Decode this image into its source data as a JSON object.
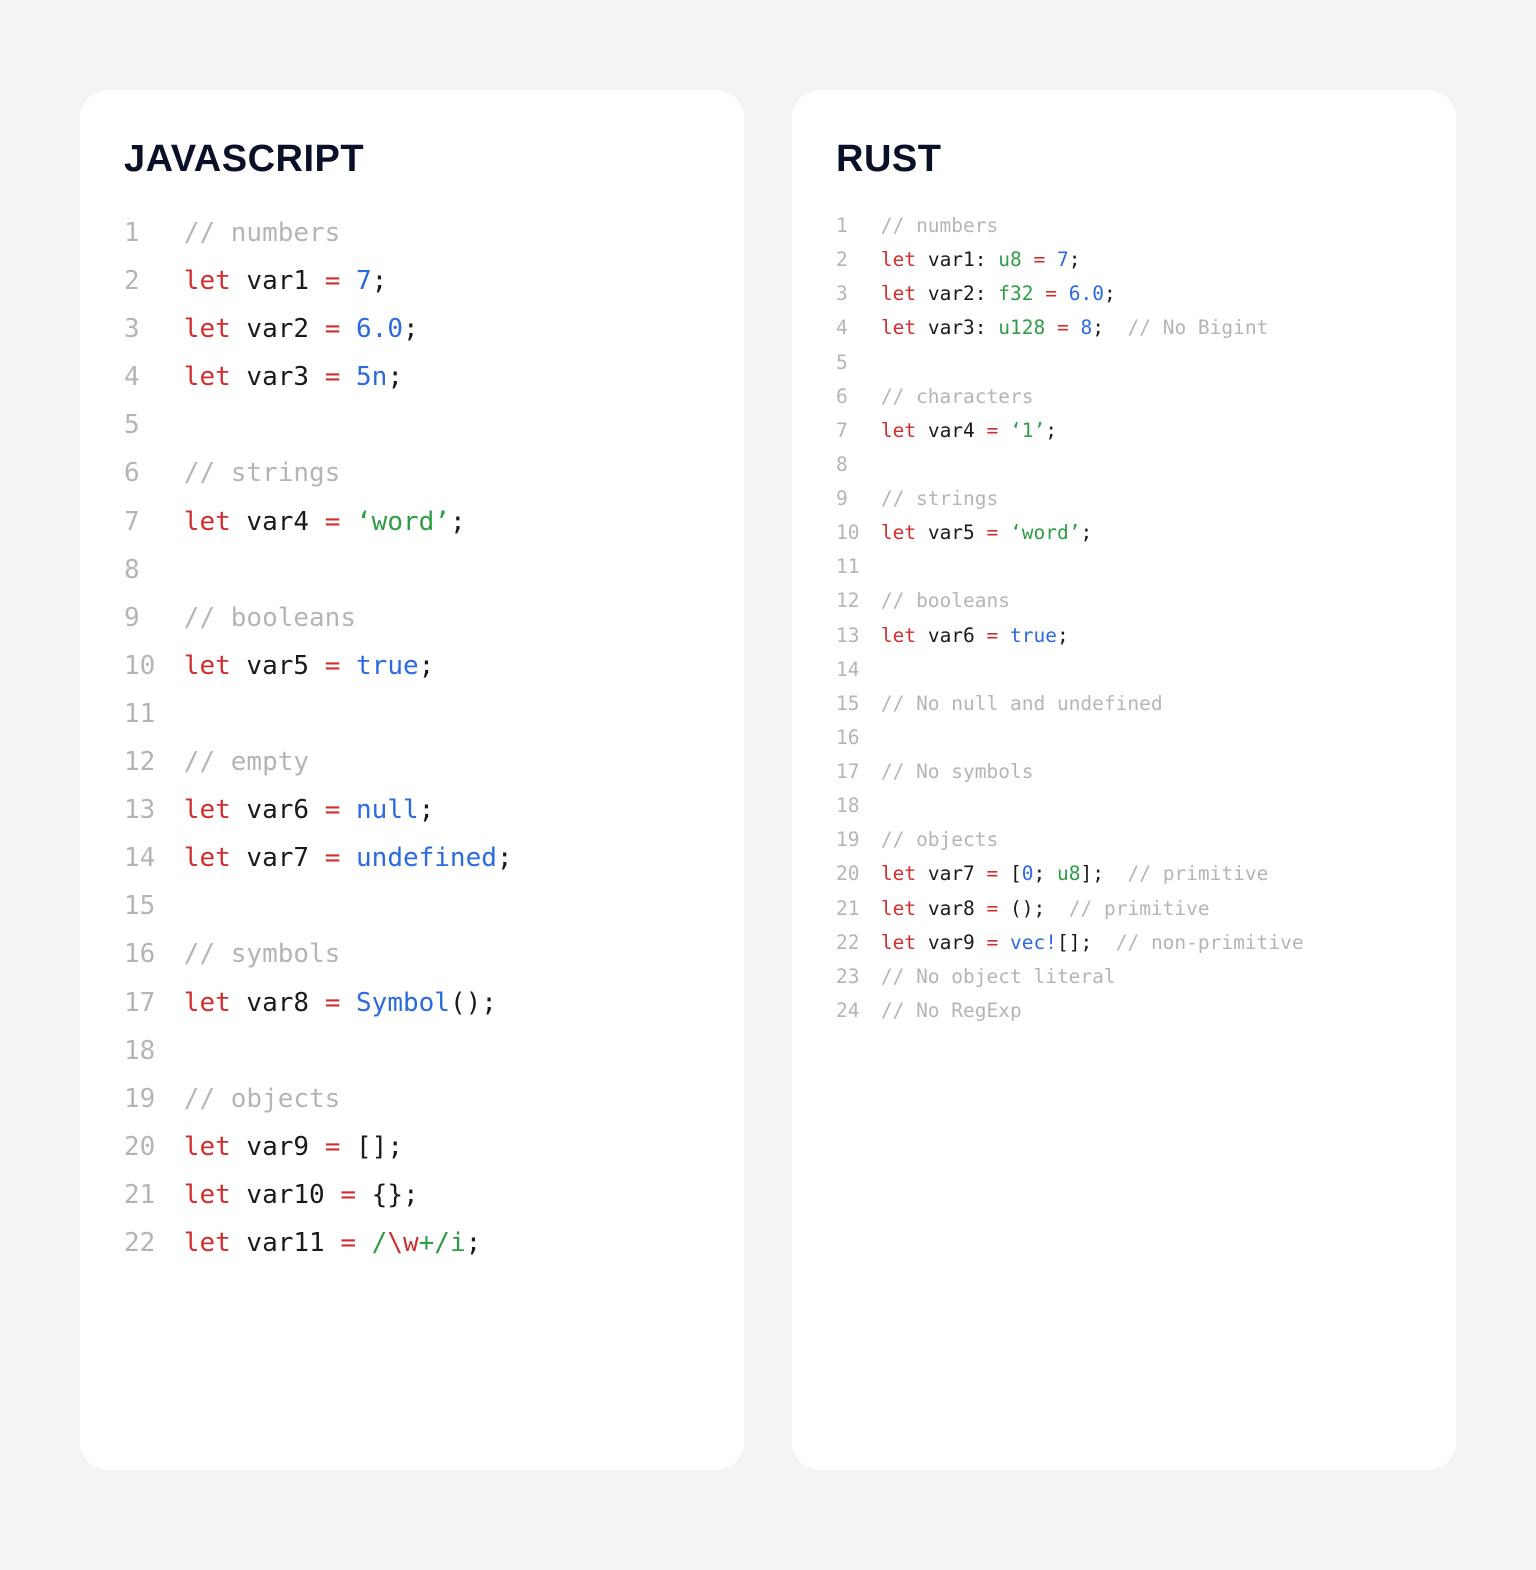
{
  "left": {
    "title": "JAVASCRIPT",
    "lines": [
      {
        "n": "1",
        "segs": [
          [
            "cm",
            "// numbers"
          ]
        ]
      },
      {
        "n": "2",
        "segs": [
          [
            "kw",
            "let"
          ],
          [
            "pn",
            " "
          ],
          [
            "nm",
            "var1"
          ],
          [
            "pn",
            " "
          ],
          [
            "op",
            "="
          ],
          [
            "pn",
            " "
          ],
          [
            "nu",
            "7"
          ],
          [
            "pn",
            ";"
          ]
        ]
      },
      {
        "n": "3",
        "segs": [
          [
            "kw",
            "let"
          ],
          [
            "pn",
            " "
          ],
          [
            "nm",
            "var2"
          ],
          [
            "pn",
            " "
          ],
          [
            "op",
            "="
          ],
          [
            "pn",
            " "
          ],
          [
            "nu",
            "6.0"
          ],
          [
            "pn",
            ";"
          ]
        ]
      },
      {
        "n": "4",
        "segs": [
          [
            "kw",
            "let"
          ],
          [
            "pn",
            " "
          ],
          [
            "nm",
            "var3"
          ],
          [
            "pn",
            " "
          ],
          [
            "op",
            "="
          ],
          [
            "pn",
            " "
          ],
          [
            "nu",
            "5n"
          ],
          [
            "pn",
            ";"
          ]
        ]
      },
      {
        "n": "5",
        "segs": [
          [
            "pn",
            ""
          ]
        ]
      },
      {
        "n": "6",
        "segs": [
          [
            "cm",
            "// strings"
          ]
        ]
      },
      {
        "n": "7",
        "segs": [
          [
            "kw",
            "let"
          ],
          [
            "pn",
            " "
          ],
          [
            "nm",
            "var4"
          ],
          [
            "pn",
            " "
          ],
          [
            "op",
            "="
          ],
          [
            "pn",
            " "
          ],
          [
            "st",
            "‘word’"
          ],
          [
            "pn",
            ";"
          ]
        ]
      },
      {
        "n": "8",
        "segs": [
          [
            "pn",
            ""
          ]
        ]
      },
      {
        "n": "9",
        "segs": [
          [
            "cm",
            "// booleans"
          ]
        ]
      },
      {
        "n": "10",
        "segs": [
          [
            "kw",
            "let"
          ],
          [
            "pn",
            " "
          ],
          [
            "nm",
            "var5"
          ],
          [
            "pn",
            " "
          ],
          [
            "op",
            "="
          ],
          [
            "pn",
            " "
          ],
          [
            "nu",
            "true"
          ],
          [
            "pn",
            ";"
          ]
        ]
      },
      {
        "n": "11",
        "segs": [
          [
            "pn",
            ""
          ]
        ]
      },
      {
        "n": "12",
        "segs": [
          [
            "cm",
            "// empty"
          ]
        ]
      },
      {
        "n": "13",
        "segs": [
          [
            "kw",
            "let"
          ],
          [
            "pn",
            " "
          ],
          [
            "nm",
            "var6"
          ],
          [
            "pn",
            " "
          ],
          [
            "op",
            "="
          ],
          [
            "pn",
            " "
          ],
          [
            "nu",
            "null"
          ],
          [
            "pn",
            ";"
          ]
        ]
      },
      {
        "n": "14",
        "segs": [
          [
            "kw",
            "let"
          ],
          [
            "pn",
            " "
          ],
          [
            "nm",
            "var7"
          ],
          [
            "pn",
            " "
          ],
          [
            "op",
            "="
          ],
          [
            "pn",
            " "
          ],
          [
            "nu",
            "undefined"
          ],
          [
            "pn",
            ";"
          ]
        ]
      },
      {
        "n": "15",
        "segs": [
          [
            "pn",
            ""
          ]
        ]
      },
      {
        "n": "16",
        "segs": [
          [
            "cm",
            "// symbols"
          ]
        ]
      },
      {
        "n": "17",
        "segs": [
          [
            "kw",
            "let"
          ],
          [
            "pn",
            " "
          ],
          [
            "nm",
            "var8"
          ],
          [
            "pn",
            " "
          ],
          [
            "op",
            "="
          ],
          [
            "pn",
            " "
          ],
          [
            "nu",
            "Symbol"
          ],
          [
            "pn",
            "();"
          ]
        ]
      },
      {
        "n": "18",
        "segs": [
          [
            "pn",
            ""
          ]
        ]
      },
      {
        "n": "19",
        "segs": [
          [
            "cm",
            "// objects"
          ]
        ]
      },
      {
        "n": "20",
        "segs": [
          [
            "kw",
            "let"
          ],
          [
            "pn",
            " "
          ],
          [
            "nm",
            "var9"
          ],
          [
            "pn",
            " "
          ],
          [
            "op",
            "="
          ],
          [
            "pn",
            " [];"
          ]
        ]
      },
      {
        "n": "21",
        "segs": [
          [
            "kw",
            "let"
          ],
          [
            "pn",
            " "
          ],
          [
            "nm",
            "var10"
          ],
          [
            "pn",
            " "
          ],
          [
            "op",
            "="
          ],
          [
            "pn",
            " {};"
          ]
        ]
      },
      {
        "n": "22",
        "segs": [
          [
            "kw",
            "let"
          ],
          [
            "pn",
            " "
          ],
          [
            "nm",
            "var11"
          ],
          [
            "pn",
            " "
          ],
          [
            "op",
            "="
          ],
          [
            "pn",
            " "
          ],
          [
            "st",
            "/"
          ],
          [
            "op",
            "\\w"
          ],
          [
            "st",
            "+/i"
          ],
          [
            "pn",
            ";"
          ]
        ]
      }
    ]
  },
  "right": {
    "title": "RUST",
    "lines": [
      {
        "n": "1",
        "segs": [
          [
            "cm",
            "// numbers"
          ]
        ]
      },
      {
        "n": "2",
        "segs": [
          [
            "kw",
            "let"
          ],
          [
            "pn",
            " "
          ],
          [
            "nm",
            "var1"
          ],
          [
            "pn",
            ": "
          ],
          [
            "tp",
            "u8"
          ],
          [
            "pn",
            " "
          ],
          [
            "op",
            "="
          ],
          [
            "pn",
            " "
          ],
          [
            "nu",
            "7"
          ],
          [
            "pn",
            ";"
          ]
        ]
      },
      {
        "n": "3",
        "segs": [
          [
            "kw",
            "let"
          ],
          [
            "pn",
            " "
          ],
          [
            "nm",
            "var2"
          ],
          [
            "pn",
            ": "
          ],
          [
            "tp",
            "f32"
          ],
          [
            "pn",
            " "
          ],
          [
            "op",
            "="
          ],
          [
            "pn",
            " "
          ],
          [
            "nu",
            "6.0"
          ],
          [
            "pn",
            ";"
          ]
        ]
      },
      {
        "n": "4",
        "segs": [
          [
            "kw",
            "let"
          ],
          [
            "pn",
            " "
          ],
          [
            "nm",
            "var3"
          ],
          [
            "pn",
            ": "
          ],
          [
            "tp",
            "u128"
          ],
          [
            "pn",
            " "
          ],
          [
            "op",
            "="
          ],
          [
            "pn",
            " "
          ],
          [
            "nu",
            "8"
          ],
          [
            "pn",
            ";  "
          ],
          [
            "cm",
            "// No Bigint"
          ]
        ]
      },
      {
        "n": "5",
        "segs": [
          [
            "pn",
            ""
          ]
        ]
      },
      {
        "n": "6",
        "segs": [
          [
            "cm",
            "// characters"
          ]
        ]
      },
      {
        "n": "7",
        "segs": [
          [
            "kw",
            "let"
          ],
          [
            "pn",
            " "
          ],
          [
            "nm",
            "var4"
          ],
          [
            "pn",
            " "
          ],
          [
            "op",
            "="
          ],
          [
            "pn",
            " "
          ],
          [
            "ch",
            "‘1’"
          ],
          [
            "pn",
            ";"
          ]
        ]
      },
      {
        "n": "8",
        "segs": [
          [
            "pn",
            ""
          ]
        ]
      },
      {
        "n": "9",
        "segs": [
          [
            "cm",
            "// strings"
          ]
        ]
      },
      {
        "n": "10",
        "segs": [
          [
            "kw",
            "let"
          ],
          [
            "pn",
            " "
          ],
          [
            "nm",
            "var5"
          ],
          [
            "pn",
            " "
          ],
          [
            "op",
            "="
          ],
          [
            "pn",
            " "
          ],
          [
            "st",
            "‘word’"
          ],
          [
            "pn",
            ";"
          ]
        ]
      },
      {
        "n": "11",
        "segs": [
          [
            "pn",
            ""
          ]
        ]
      },
      {
        "n": "12",
        "segs": [
          [
            "cm",
            "// booleans"
          ]
        ]
      },
      {
        "n": "13",
        "segs": [
          [
            "kw",
            "let"
          ],
          [
            "pn",
            " "
          ],
          [
            "nm",
            "var6"
          ],
          [
            "pn",
            " "
          ],
          [
            "op",
            "="
          ],
          [
            "pn",
            " "
          ],
          [
            "nu",
            "true"
          ],
          [
            "pn",
            ";"
          ]
        ]
      },
      {
        "n": "14",
        "segs": [
          [
            "pn",
            ""
          ]
        ]
      },
      {
        "n": "15",
        "segs": [
          [
            "cm",
            "// No null and undefined"
          ]
        ]
      },
      {
        "n": "16",
        "segs": [
          [
            "pn",
            ""
          ]
        ]
      },
      {
        "n": "17",
        "segs": [
          [
            "cm",
            "// No symbols"
          ]
        ]
      },
      {
        "n": "18",
        "segs": [
          [
            "pn",
            ""
          ]
        ]
      },
      {
        "n": "19",
        "segs": [
          [
            "cm",
            "// objects"
          ]
        ]
      },
      {
        "n": "20",
        "segs": [
          [
            "kw",
            "let"
          ],
          [
            "pn",
            " "
          ],
          [
            "nm",
            "var7"
          ],
          [
            "pn",
            " "
          ],
          [
            "op",
            "="
          ],
          [
            "pn",
            " ["
          ],
          [
            "nu",
            "0"
          ],
          [
            "pn",
            "; "
          ],
          [
            "tp",
            "u8"
          ],
          [
            "pn",
            "];  "
          ],
          [
            "cm",
            "// primitive"
          ]
        ]
      },
      {
        "n": "21",
        "segs": [
          [
            "kw",
            "let"
          ],
          [
            "pn",
            " "
          ],
          [
            "nm",
            "var8"
          ],
          [
            "pn",
            " "
          ],
          [
            "op",
            "="
          ],
          [
            "pn",
            " ();  "
          ],
          [
            "cm",
            "// primitive"
          ]
        ]
      },
      {
        "n": "22",
        "segs": [
          [
            "kw",
            "let"
          ],
          [
            "pn",
            " "
          ],
          [
            "nm",
            "var9"
          ],
          [
            "pn",
            " "
          ],
          [
            "op",
            "="
          ],
          [
            "pn",
            " "
          ],
          [
            "nu",
            "vec!"
          ],
          [
            "pn",
            "[];  "
          ],
          [
            "cm",
            "// non-primitive"
          ]
        ]
      },
      {
        "n": "23",
        "segs": [
          [
            "cm",
            "// No object literal"
          ]
        ]
      },
      {
        "n": "24",
        "segs": [
          [
            "cm",
            "// No RegExp"
          ]
        ]
      }
    ]
  }
}
